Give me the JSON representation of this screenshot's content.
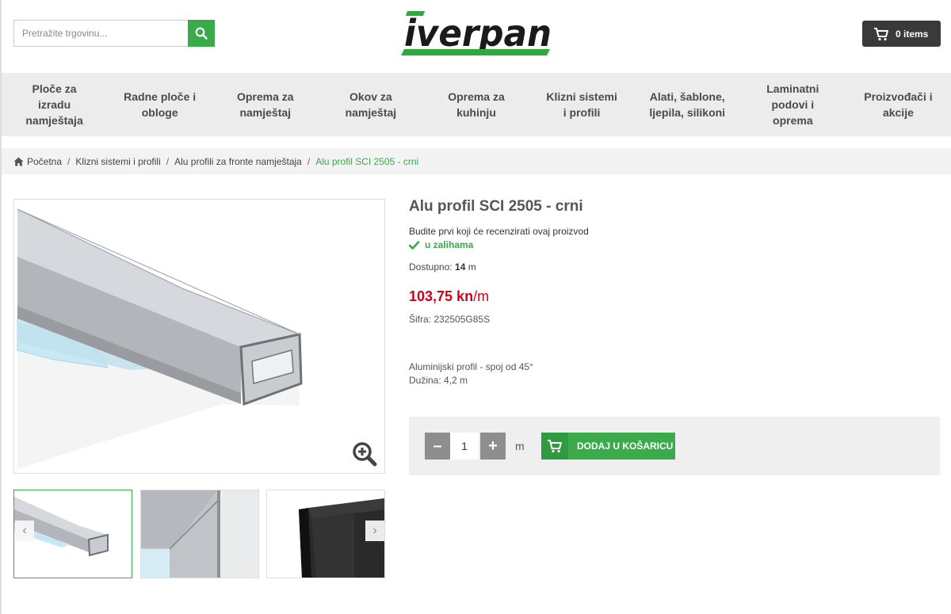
{
  "search": {
    "placeholder": "Pretražite trgovinu..."
  },
  "logo": {
    "text": "iverpan",
    "brand_color": "#1a1a1a",
    "accent_color": "#2eaa3c"
  },
  "cart": {
    "label": "0 items"
  },
  "nav": {
    "items": [
      {
        "label": "Ploče za izradu namještaja"
      },
      {
        "label": "Radne ploče i obloge"
      },
      {
        "label": "Oprema za namještaj"
      },
      {
        "label": "Okov za namještaj"
      },
      {
        "label": "Oprema za kuhinju"
      },
      {
        "label": "Klizni sistemi i profili"
      },
      {
        "label": "Alati, šablone, ljepila, silikoni"
      },
      {
        "label": "Laminatni podovi i oprema"
      },
      {
        "label": "Proizvođači i akcije"
      }
    ]
  },
  "breadcrumb": {
    "items": [
      "Početna",
      "Klizni sistemi i profili",
      "Alu profili za fronte namještaja"
    ],
    "current": "Alu profil SCI 2505 - crni",
    "separator": "/"
  },
  "product": {
    "title": "Alu profil SCI 2505 - crni",
    "review_link": "Budite prvi koji će recenzirati ovaj proizvod",
    "stock": "u zalihama",
    "available_label": "Dostupno:",
    "available_qty": "14",
    "available_unit": "m",
    "price": "103,75 kn",
    "price_unit": "/m",
    "sku_label": "Šifra:",
    "sku": "232505G85S",
    "description": [
      "Aluminijski profil - spoj od 45°",
      "Dužina: 4,2 m"
    ]
  },
  "buy": {
    "minus": "–",
    "plus": "+",
    "quantity": "1",
    "unit": "m",
    "add_to_cart": "DODAJ U KOŠARICU"
  },
  "gallery": {
    "prev": "‹",
    "next": "›"
  },
  "colors": {
    "green": "#3aaa4a",
    "price_red": "#d0021b",
    "nav_bg": "#ececec",
    "cart_bg": "#3a3a3a"
  }
}
